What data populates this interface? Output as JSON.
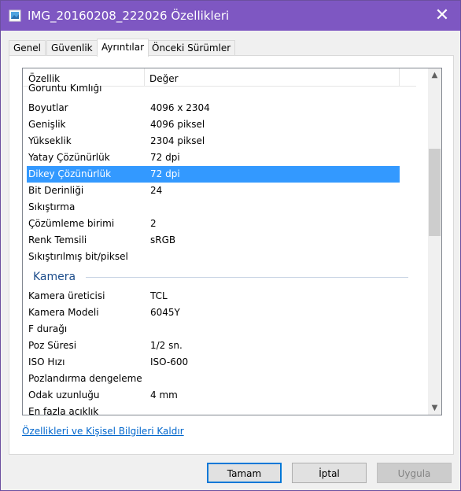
{
  "window": {
    "title": "IMG_20160208_222026 Özellikleri",
    "close_label": "✕"
  },
  "tabs": [
    {
      "label": "Genel"
    },
    {
      "label": "Güvenlik"
    },
    {
      "label": "Ayrıntılar"
    },
    {
      "label": "Önceki Sürümler"
    }
  ],
  "list": {
    "header": {
      "property": "Özellik",
      "value": "Değer"
    },
    "partial_top": "Goruntu Kımlığı",
    "rows": [
      {
        "key": "Boyutlar",
        "value": "4096 x 2304"
      },
      {
        "key": "Genişlik",
        "value": "4096 piksel"
      },
      {
        "key": "Yükseklik",
        "value": "2304 piksel"
      },
      {
        "key": "Yatay Çözünürlük",
        "value": "72 dpi"
      },
      {
        "key": "Dikey Çözünürlük",
        "value": "72 dpi"
      },
      {
        "key": "Bit Derinliği",
        "value": "24"
      },
      {
        "key": "Sıkıştırma",
        "value": ""
      },
      {
        "key": "Çözümleme birimi",
        "value": "2"
      },
      {
        "key": "Renk Temsili",
        "value": "sRGB"
      },
      {
        "key": "Sıkıştırılmış bit/piksel",
        "value": ""
      }
    ],
    "group": "Kamera",
    "camera_rows": [
      {
        "key": "Kamera üreticisi",
        "value": "TCL"
      },
      {
        "key": "Kamera Modeli",
        "value": "6045Y"
      },
      {
        "key": "F durağı",
        "value": ""
      },
      {
        "key": "Poz Süresi",
        "value": "1/2 sn."
      },
      {
        "key": "ISO Hızı",
        "value": "ISO-600"
      },
      {
        "key": "Pozlandırma dengeleme",
        "value": ""
      },
      {
        "key": "Odak uzunluğu",
        "value": "4 mm"
      }
    ],
    "partial_bottom": "En fazla açıklık",
    "selected_key": "Dikey Çözünürlük"
  },
  "link": "Özellikleri ve Kişisel Bilgileri Kaldır",
  "buttons": {
    "ok": "Tamam",
    "cancel": "İptal",
    "apply": "Uygula"
  },
  "colors": {
    "titlebar": "#7e57c2",
    "selection": "#3399ff",
    "link": "#0066cc"
  }
}
